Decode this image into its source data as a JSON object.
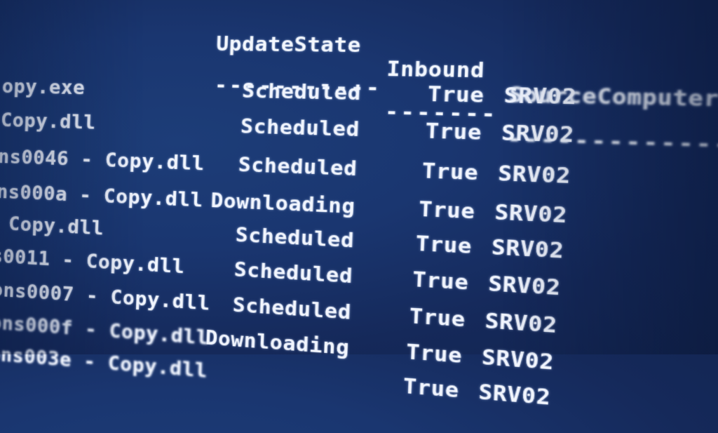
{
  "terminal": {
    "headers": {
      "update_state": "UpdateState",
      "inbound": "Inbound",
      "source_computer_name": "SourceComputerName"
    },
    "separators": {
      "update_state": "-----------",
      "inbound": "-------",
      "source_computer_name": "------------------"
    },
    "rows": [
      {
        "name": "opy.exe",
        "state": "Scheduled",
        "inbound": "True",
        "source": "SRV02"
      },
      {
        "name": "Copy.dll",
        "state": "Scheduled",
        "inbound": "True",
        "source": "SRV02"
      },
      {
        "name": "ns0046 - Copy.dll",
        "state": "Scheduled",
        "inbound": "True",
        "source": "SRV02"
      },
      {
        "name": "ns000a - Copy.dll",
        "state": "Downloading",
        "inbound": "True",
        "source": "SRV02"
      },
      {
        "name": " Copy.dll",
        "state": "Scheduled",
        "inbound": "True",
        "source": "SRV02"
      },
      {
        "name": "s0011 - Copy.dll",
        "state": "Scheduled",
        "inbound": "True",
        "source": "SRV02"
      },
      {
        "name": "ons0007 - Copy.dll",
        "state": "Scheduled",
        "inbound": "True",
        "source": "SRV02"
      },
      {
        "name": "ons000f - Copy.dll",
        "state": "Downloading",
        "inbound": "True",
        "source": "SRV02"
      },
      {
        "name": "ons003e - Copy.dll",
        "state": "",
        "inbound": "True",
        "source": "SRV02"
      }
    ]
  }
}
